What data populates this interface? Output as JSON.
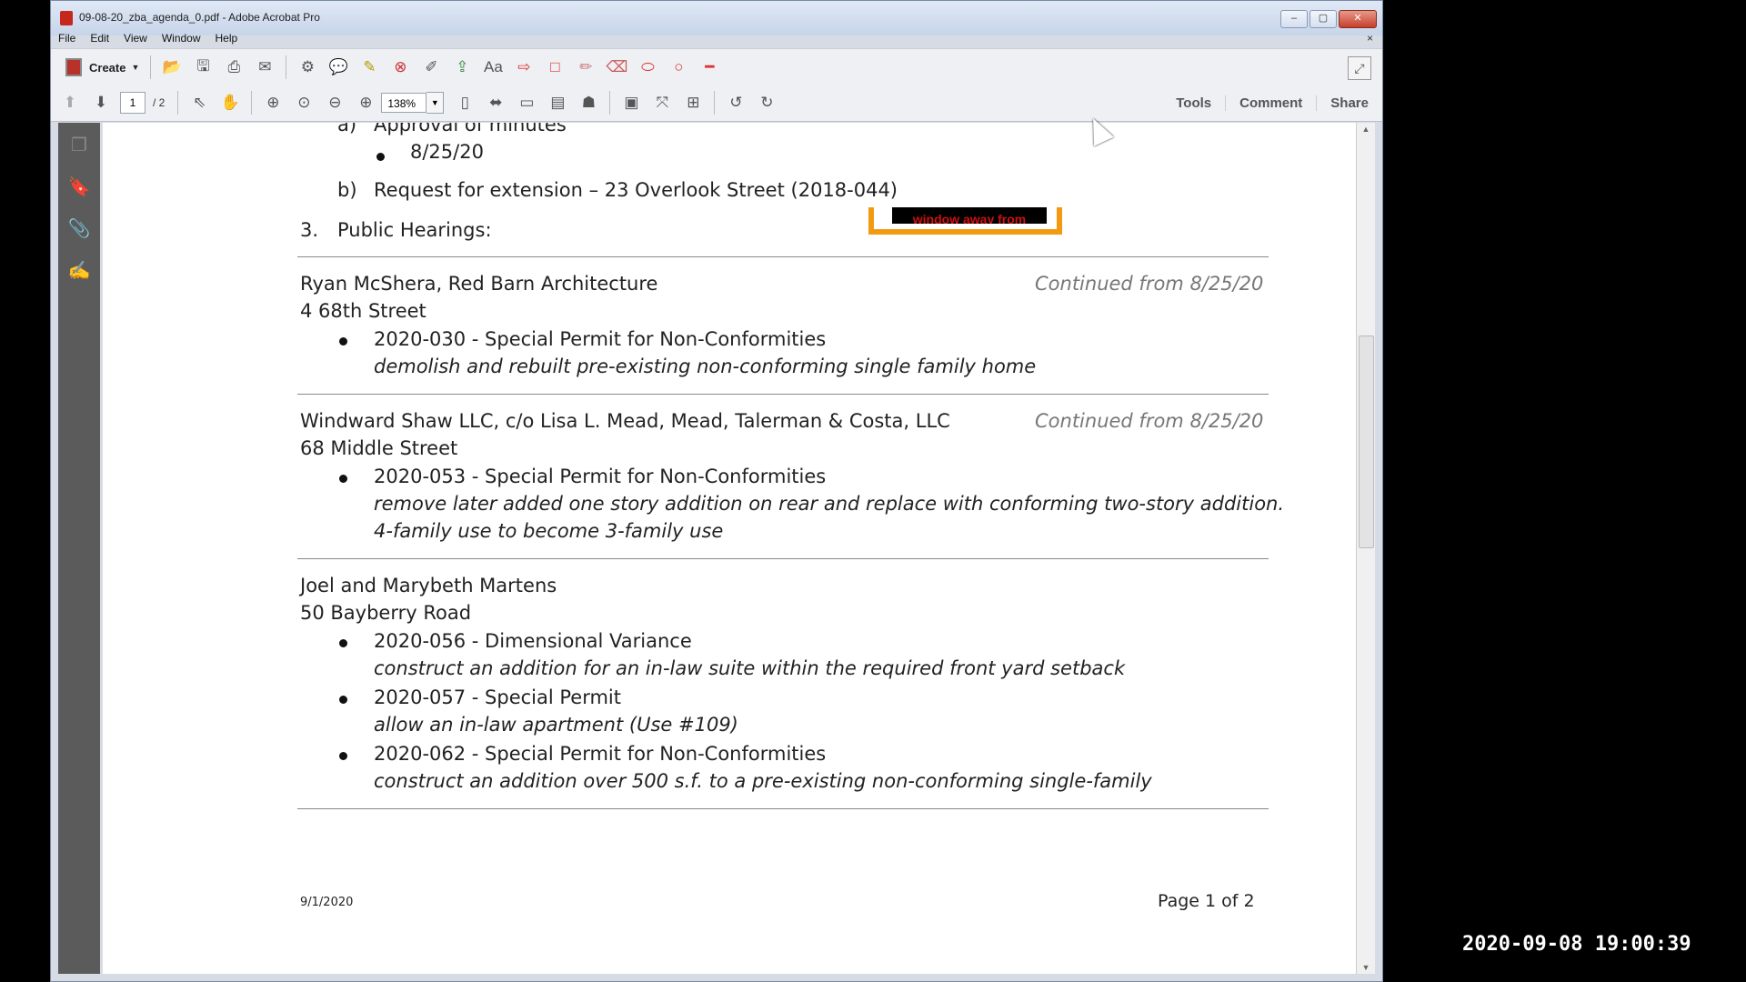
{
  "window": {
    "title": "09-08-20_zba_agenda_0.pdf - Adobe Acrobat Pro",
    "controls": {
      "minimize": "–",
      "maximize": "▢",
      "close": "✕"
    }
  },
  "menu": {
    "items": [
      "File",
      "Edit",
      "View",
      "Window",
      "Help"
    ],
    "close_doc": "×"
  },
  "toolbar": {
    "create_label": "Create",
    "page_current": "1",
    "page_total": "/ 2",
    "zoom": "138%",
    "tools": "Tools",
    "comment": "Comment",
    "share": "Share"
  },
  "document": {
    "item_a": "a)",
    "item_a_text": "Approval of minutes",
    "item_a_bullet": "8/25/20",
    "item_b": "b)",
    "item_b_text": "Request for extension – 23 Overlook Street (2018-044)",
    "item_3": "3.",
    "item_3_text": "Public Hearings:",
    "hearings": [
      {
        "applicant": "Ryan McShera, Red Barn Architecture",
        "address": "4 68th Street",
        "continued": "Continued from 8/25/20",
        "items": [
          {
            "title": "2020-030 - Special Permit for Non-Conformities",
            "desc": "demolish and rebuilt pre-existing non-conforming single family home"
          }
        ]
      },
      {
        "applicant": "Windward Shaw LLC, c/o Lisa L. Mead, Mead, Talerman & Costa, LLC",
        "address": "68 Middle Street",
        "continued": "Continued from 8/25/20",
        "items": [
          {
            "title": "2020-053 - Special Permit for Non-Conformities",
            "desc": "remove later added one story addition on rear and replace with conforming two-story addition.",
            "desc2": "4-family use to become 3-family use"
          }
        ]
      },
      {
        "applicant": "Joel and Marybeth Martens",
        "address": "50 Bayberry Road",
        "items": [
          {
            "title": "2020-056 - Dimensional Variance",
            "desc": "construct an addition for an in-law suite within the required front yard setback"
          },
          {
            "title": "2020-057 - Special Permit",
            "desc": "allow an in-law apartment (Use #109)"
          },
          {
            "title": "2020-062 - Special Permit for Non-Conformities",
            "desc": "construct an addition over 500 s.f. to a pre-existing non-conforming single-family"
          }
        ]
      }
    ],
    "footer_date": "9/1/2020",
    "footer_page": "Page 1 of 2"
  },
  "overlay_text": "window away from",
  "video_timestamp": "2020-09-08 19:00:39"
}
